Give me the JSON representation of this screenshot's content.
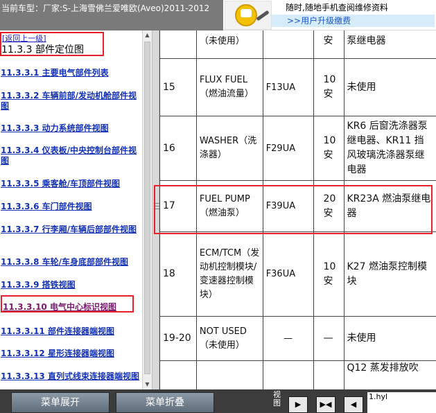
{
  "header": {
    "vehicle_title": "当前车型：厂家:S-上海雪佛兰爱唯欧(Aveo)2011-2012",
    "ad_text": "随时,随地手机查阅维修资料",
    "ad_link": ">>用户升级缴费"
  },
  "left_nav": {
    "back_label": "[返回上一级]",
    "section_title": "11.3.3 部件定位图",
    "items": [
      {
        "label": "11.3.3.1 主要电气部件列表"
      },
      {
        "label": "11.3.3.2 车辆前部/发动机舱部件视图"
      },
      {
        "label": "11.3.3.3 动力系统部件视图"
      },
      {
        "label": "11.3.3.4 仪表板/中央控制台部件视图"
      },
      {
        "label": "11.3.3.5 乘客舱/车顶部件视图"
      },
      {
        "label": "11.3.3.6 车门部件视图"
      },
      {
        "label": "11.3.3.7 行李厢/车辆后部部件视图"
      },
      {
        "label": "11.3.3.8 车轮/车身底部部件视图"
      },
      {
        "label": "11.3.3.9 搭铁视图"
      },
      {
        "label": "11.3.3.10 电气中心标识视图"
      },
      {
        "label": "11.3.3.11 部件连接器端视图"
      },
      {
        "label": "11.3.3.12 星形连接器端视图"
      },
      {
        "label": "11.3.3.13 直列式线束连接器端视图"
      }
    ],
    "active_index": 9
  },
  "fuse_table": {
    "rows": [
      {
        "no": "",
        "name": "（未使用）",
        "fuse": "",
        "amp": "安",
        "usage": "泵继电器"
      },
      {
        "no": "15",
        "name": "FLUX FUEL（燃油流量）",
        "fuse": "F13UA",
        "amp": "10安",
        "usage": "未使用"
      },
      {
        "no": "16",
        "name": "WASHER（洗涤器）",
        "fuse": "F29UA",
        "amp": "10安",
        "usage": "KR6 后窗洗涤器泵继电器、KR11 挡风玻璃洗涤器泵继电器"
      },
      {
        "no": "17",
        "name": "FUEL PUMP（燃油泵）",
        "fuse": "F39UA",
        "amp": "20安",
        "usage": "KR23A 燃油泵继电器"
      },
      {
        "no": "18",
        "name": "ECM/TCM（发动机控制模块/变速器控制模块）",
        "fuse": "F36UA",
        "amp": "10安",
        "usage": "K27 燃油泵控制模块"
      },
      {
        "no": "19-20",
        "name": "NOT USED（未使用）",
        "fuse": "—",
        "amp": "—",
        "usage": "未使用"
      },
      {
        "no": "",
        "name": "",
        "fuse": "",
        "amp": "",
        "usage": "Q12 蒸发排放吹"
      }
    ]
  },
  "bottom_bar": {
    "expand_label": "菜单展开",
    "collapse_label": "菜单折叠",
    "view_label": "视图",
    "view_buttons": [
      "▶",
      "▶◀",
      "◀"
    ],
    "filename": "1.hyl"
  }
}
